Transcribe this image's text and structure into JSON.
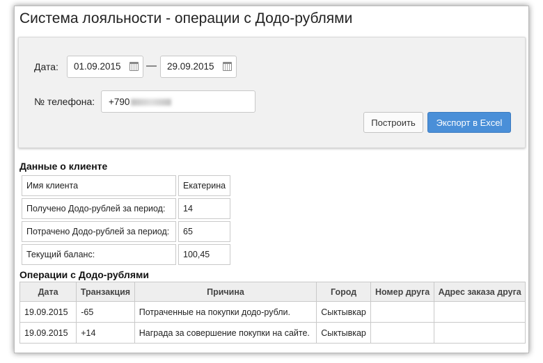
{
  "page": {
    "title": "Система лояльности - операции с Додо-рублями"
  },
  "filters": {
    "date_label": "Дата:",
    "date_from": "01.09.2015",
    "separator": "—",
    "date_to": "29.09.2015",
    "phone_label": "№ телефона:",
    "phone_value": "+790",
    "build_label": "Построить",
    "export_label": "Экспорт в Excel",
    "accent_color": "#4a8fd8"
  },
  "client": {
    "section_title": "Данные о клиенте",
    "rows": [
      {
        "key": "Имя клиента",
        "value": "Екатерина"
      },
      {
        "key": "Получено Додо-рублей за период:",
        "value": "14"
      },
      {
        "key": "Потрачено Додо-рублей за период:",
        "value": "65"
      },
      {
        "key": "Текущий баланс:",
        "value": "100,45"
      }
    ]
  },
  "operations": {
    "section_title": "Операции с Додо-рублями",
    "columns": [
      "Дата",
      "Транзакция",
      "Причина",
      "Город",
      "Номер друга",
      "Адрес заказа друга"
    ],
    "rows": [
      [
        "19.09.2015",
        "-65",
        "Потраченные на покупки додо-рубли.",
        "Сыктывкар",
        "",
        ""
      ],
      [
        "19.09.2015",
        "+14",
        "Награда за совершение покупки на сайте.",
        "Сыктывкар",
        "",
        ""
      ]
    ]
  }
}
